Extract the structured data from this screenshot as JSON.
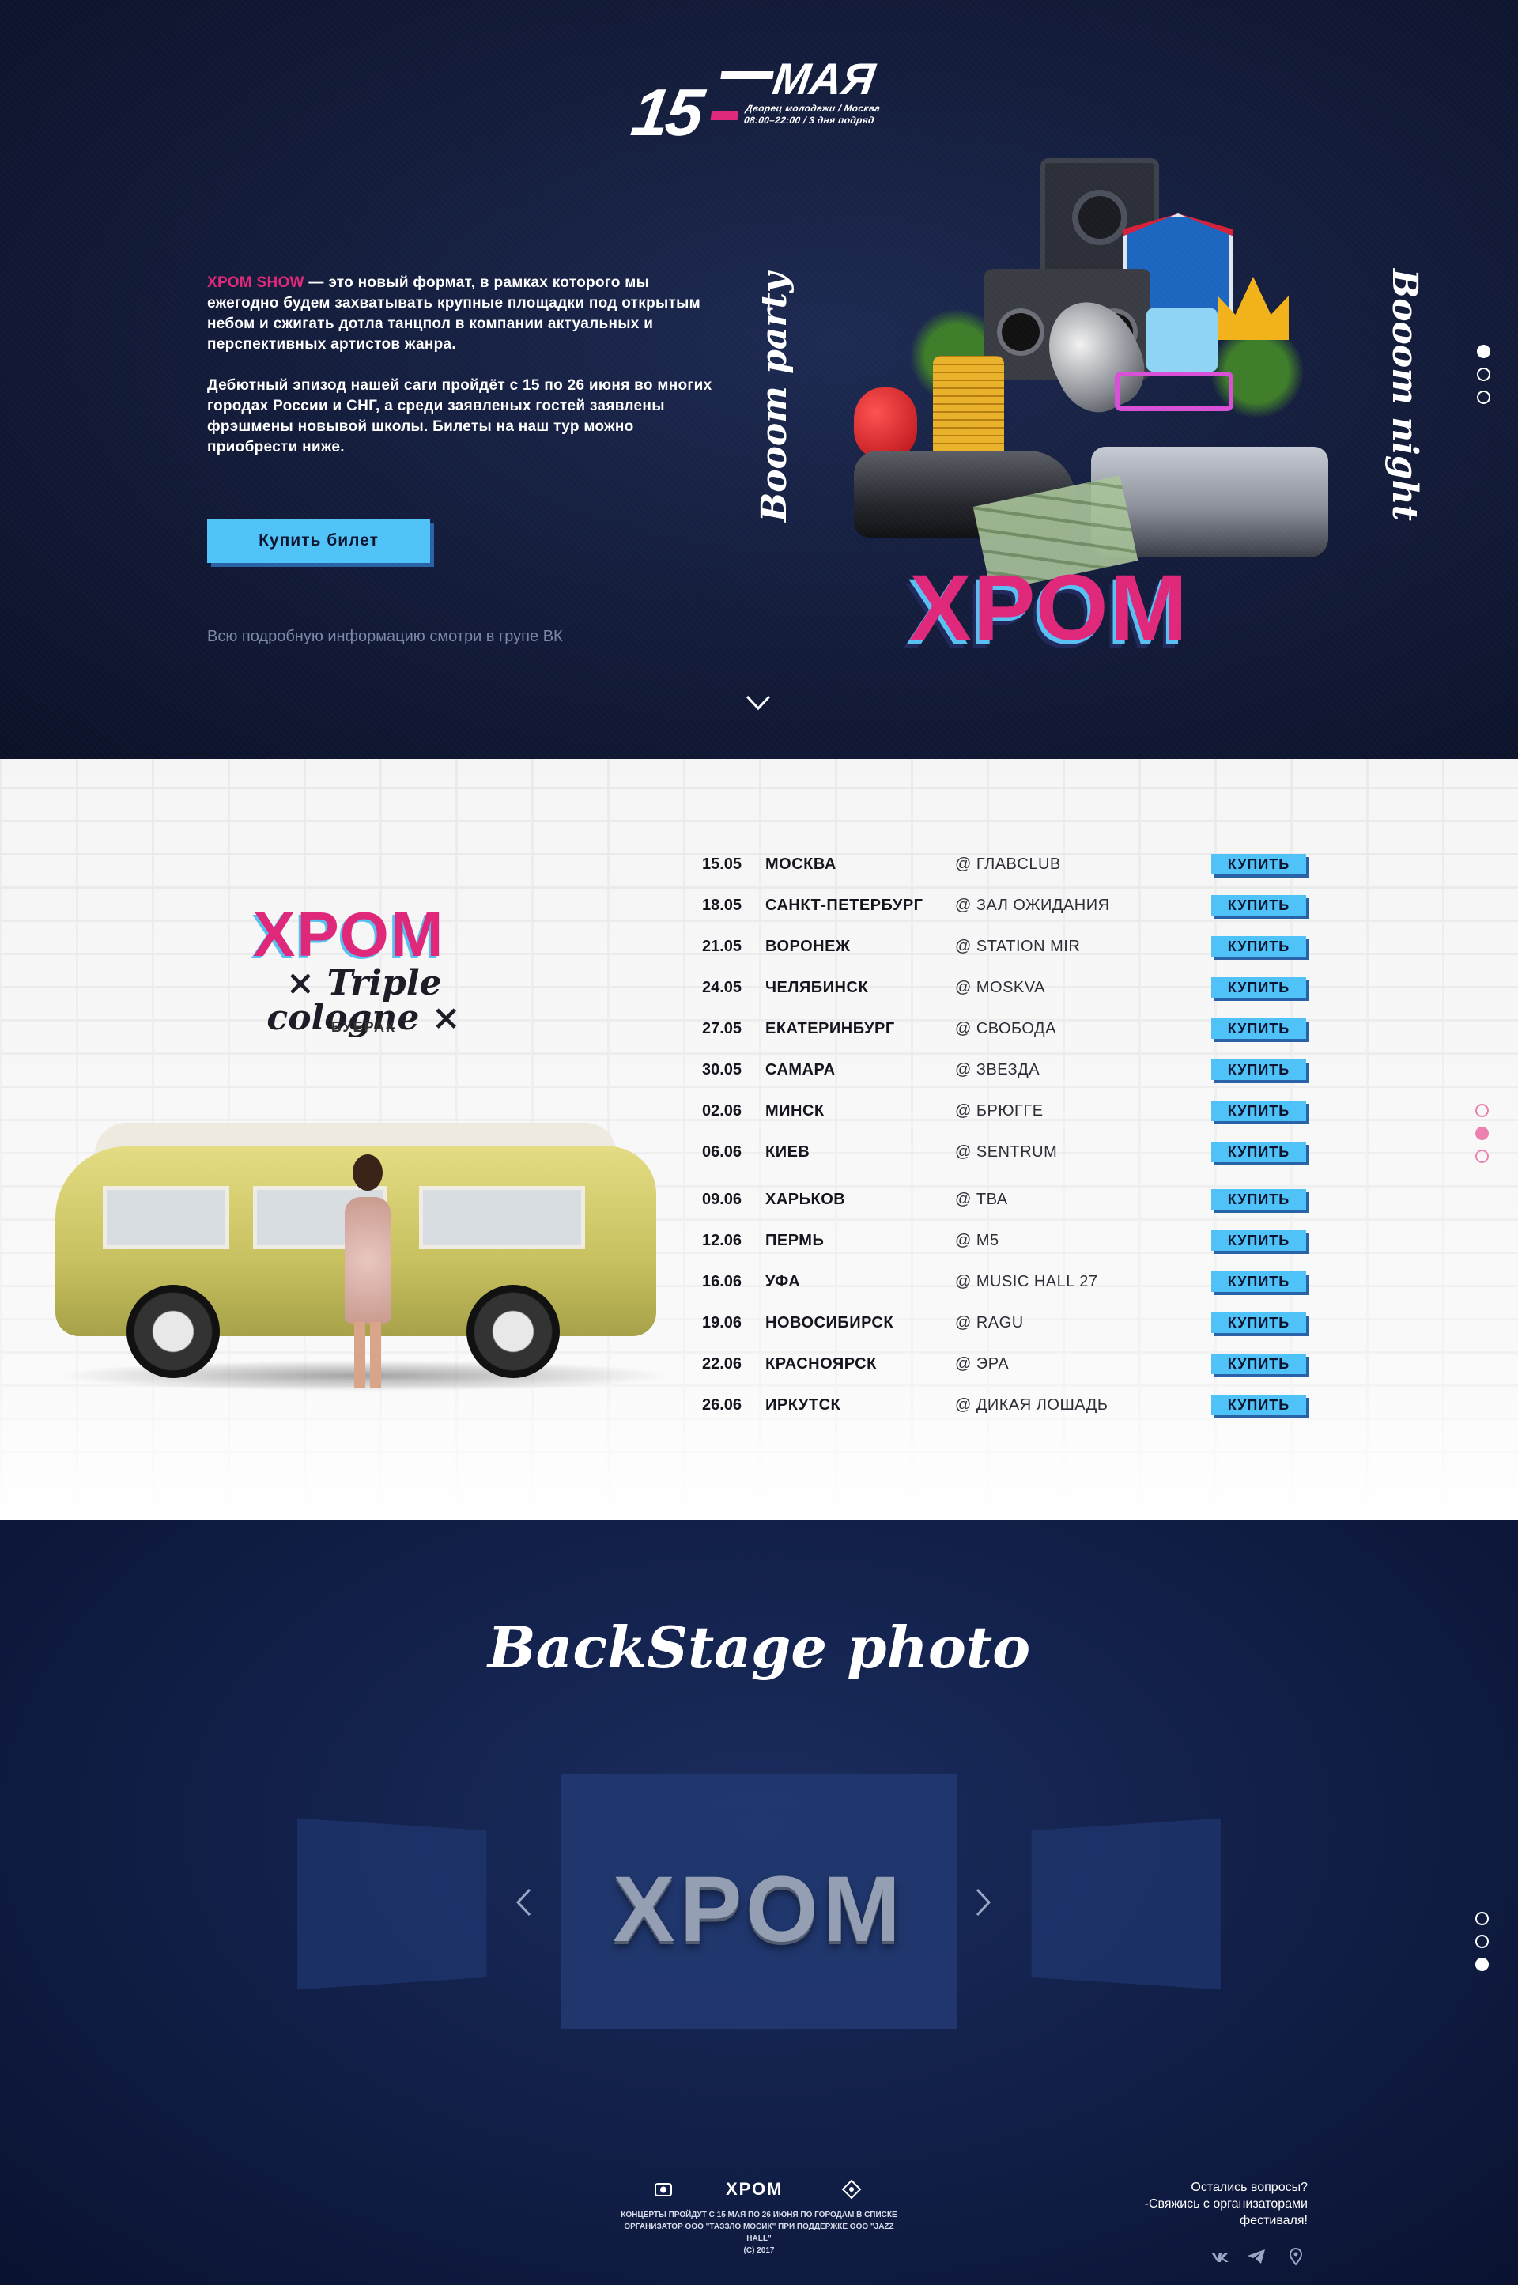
{
  "hero": {
    "date_day": "15",
    "date_month": "МАЯ",
    "date_venue_line1": "Дворец молодежи / Москва",
    "date_venue_line2": "08:00–22:00 / 3 дня подряд",
    "intro_brand": "ХРОМ SHOW",
    "intro_p1_rest": " — это новый формат, в рамках которого мы ежегодно будем захватывать крупные площадки под открытым небом и сжигать дотла танцпол в компании актуальных и перспективных артистов жанра.",
    "intro_p2": "Дебютный эпизод нашей саги пройдёт с 15 по 26 июня во многих городах России и СНГ, а среди заявленых гостей заявлены фрэшмены новывой школы. Билеты на наш тур можно приобрести ниже.",
    "buy_label": "Купить билет",
    "vk_note": "Всю подробную информацию смотри в групе ВК",
    "vertical_left": "Booom party",
    "vertical_right": "Booom night",
    "collage_logo": "ХРОМ",
    "dots": [
      true,
      false,
      false
    ]
  },
  "tour": {
    "logo": "ХРОМ",
    "subtitle": "× Triple cologne ×",
    "tagline": "БУЕРАК",
    "buy_label": "КУПИТЬ",
    "dots": [
      false,
      true,
      false
    ],
    "rows": [
      {
        "date": "15.05",
        "city": "МОСКВА",
        "venue": "@ ГЛАВCLUB"
      },
      {
        "date": "18.05",
        "city": "САНКТ-ПЕТЕРБУРГ",
        "venue": "@ ЗАЛ ОЖИДАНИЯ"
      },
      {
        "date": "21.05",
        "city": "ВОРОНЕЖ",
        "venue": "@ STATION MIR"
      },
      {
        "date": "24.05",
        "city": "ЧЕЛЯБИНСК",
        "venue": "@ MOSKVA"
      },
      {
        "date": "27.05",
        "city": "ЕКАТЕРИНБУРГ",
        "venue": "@ СВОБОДА"
      },
      {
        "date": "30.05",
        "city": "САМАРА",
        "venue": "@ ЗВЕЗДА"
      },
      {
        "date": "02.06",
        "city": "МИНСК",
        "venue": "@ БРЮГГЕ"
      },
      {
        "date": "06.06",
        "city": "КИЕВ",
        "venue": "@ SENTRUM"
      },
      {
        "date": "09.06",
        "city": "ХАРЬКОВ",
        "venue": "@ ТВА"
      },
      {
        "date": "12.06",
        "city": "ПЕРМЬ",
        "venue": "@ M5"
      },
      {
        "date": "16.06",
        "city": "УФА",
        "venue": "@ MUSIC HALL 27"
      },
      {
        "date": "19.06",
        "city": "НОВОСИБИРСК",
        "venue": "@ RAGU"
      },
      {
        "date": "22.06",
        "city": "КРАСНОЯРСК",
        "venue": "@ ЭРА"
      },
      {
        "date": "26.06",
        "city": "ИРКУТСК",
        "venue": "@ ДИКАЯ ЛОШАДЬ"
      }
    ]
  },
  "backstage": {
    "title": "BackStage photo",
    "slide_logo": "ХРОМ",
    "dots": [
      false,
      false,
      true
    ]
  },
  "footer": {
    "logo": "ХРОМ",
    "legal_line1": "КОНЦЕРТЫ ПРОЙДУТ С 15 МАЯ ПО 26 ИЮНЯ ПО ГОРОДАМ В СПИСКЕ",
    "legal_line2": "ОРГАНИЗАТОР ООО \"ТАЗЗЛО МОСИК\" ПРИ ПОДДЕРЖКЕ ООО \"JAZZ HALL\"",
    "legal_line3": "(С) 2017",
    "contact_line1": "Остались вопросы?",
    "contact_line2": "-Свяжись с организаторами",
    "contact_line3": "фестиваля!",
    "social_icons": [
      "vk-icon",
      "telegram-icon",
      "location-icon"
    ]
  },
  "colors": {
    "accent_pink": "#e0287a",
    "accent_blue": "#4fc3f7",
    "dark_navy": "#0c1430"
  }
}
